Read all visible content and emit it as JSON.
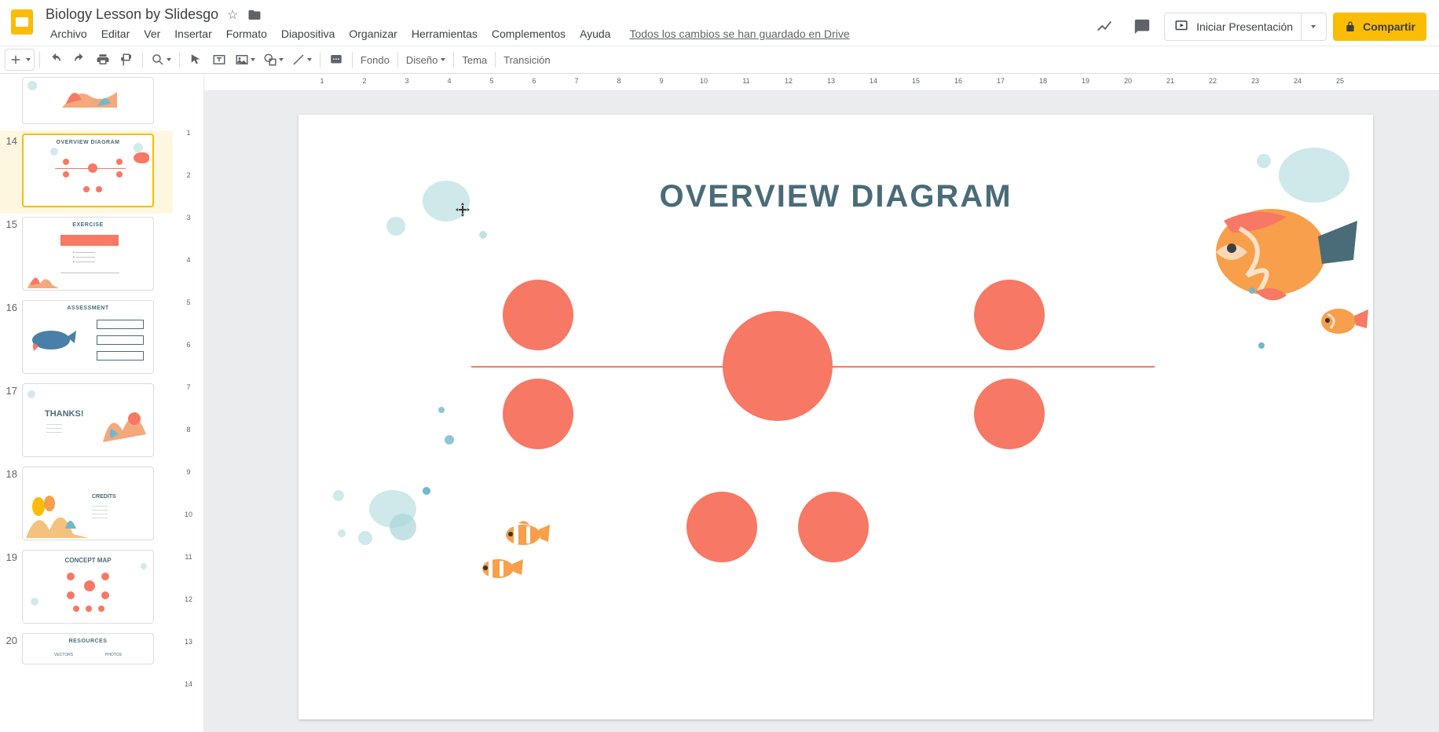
{
  "app": {
    "document_title": "Biology Lesson by Slidesgo",
    "save_status": "Todos los cambios se han guardado en Drive"
  },
  "menus": [
    "Archivo",
    "Editar",
    "Ver",
    "Insertar",
    "Formato",
    "Diapositiva",
    "Organizar",
    "Herramientas",
    "Complementos",
    "Ayuda"
  ],
  "header_actions": {
    "present_label": "Iniciar Presentación",
    "share_label": "Compartir"
  },
  "toolbar": {
    "background_label": "Fondo",
    "layout_label": "Diseño",
    "theme_label": "Tema",
    "transition_label": "Transición"
  },
  "ruler": {
    "h_ticks": [
      "1",
      "2",
      "3",
      "4",
      "5",
      "6",
      "7",
      "8",
      "9",
      "10",
      "11",
      "12",
      "13",
      "14",
      "15",
      "16",
      "17",
      "18",
      "19",
      "20",
      "21",
      "22",
      "23",
      "24",
      "25"
    ],
    "v_ticks": [
      "1",
      "2",
      "3",
      "4",
      "5",
      "6",
      "7",
      "8",
      "9",
      "10",
      "11",
      "12",
      "13",
      "14"
    ]
  },
  "thumbnails": [
    {
      "num": "",
      "label": ""
    },
    {
      "num": "14",
      "label": "OVERVIEW DIAGRAM"
    },
    {
      "num": "15",
      "label": "EXERCISE"
    },
    {
      "num": "16",
      "label": "ASSESSMENT"
    },
    {
      "num": "17",
      "label": "THANKS!"
    },
    {
      "num": "18",
      "label": "CREDITS"
    },
    {
      "num": "19",
      "label": "CONCEPT MAP"
    },
    {
      "num": "20",
      "label": "RESOURCES"
    }
  ],
  "slide": {
    "title": "OVERVIEW DIAGRAM"
  },
  "colors": {
    "coral": "#f77864",
    "teal_text": "#4a6b78",
    "bubble": "#a8d5d8",
    "share_yellow": "#fbbc04"
  }
}
